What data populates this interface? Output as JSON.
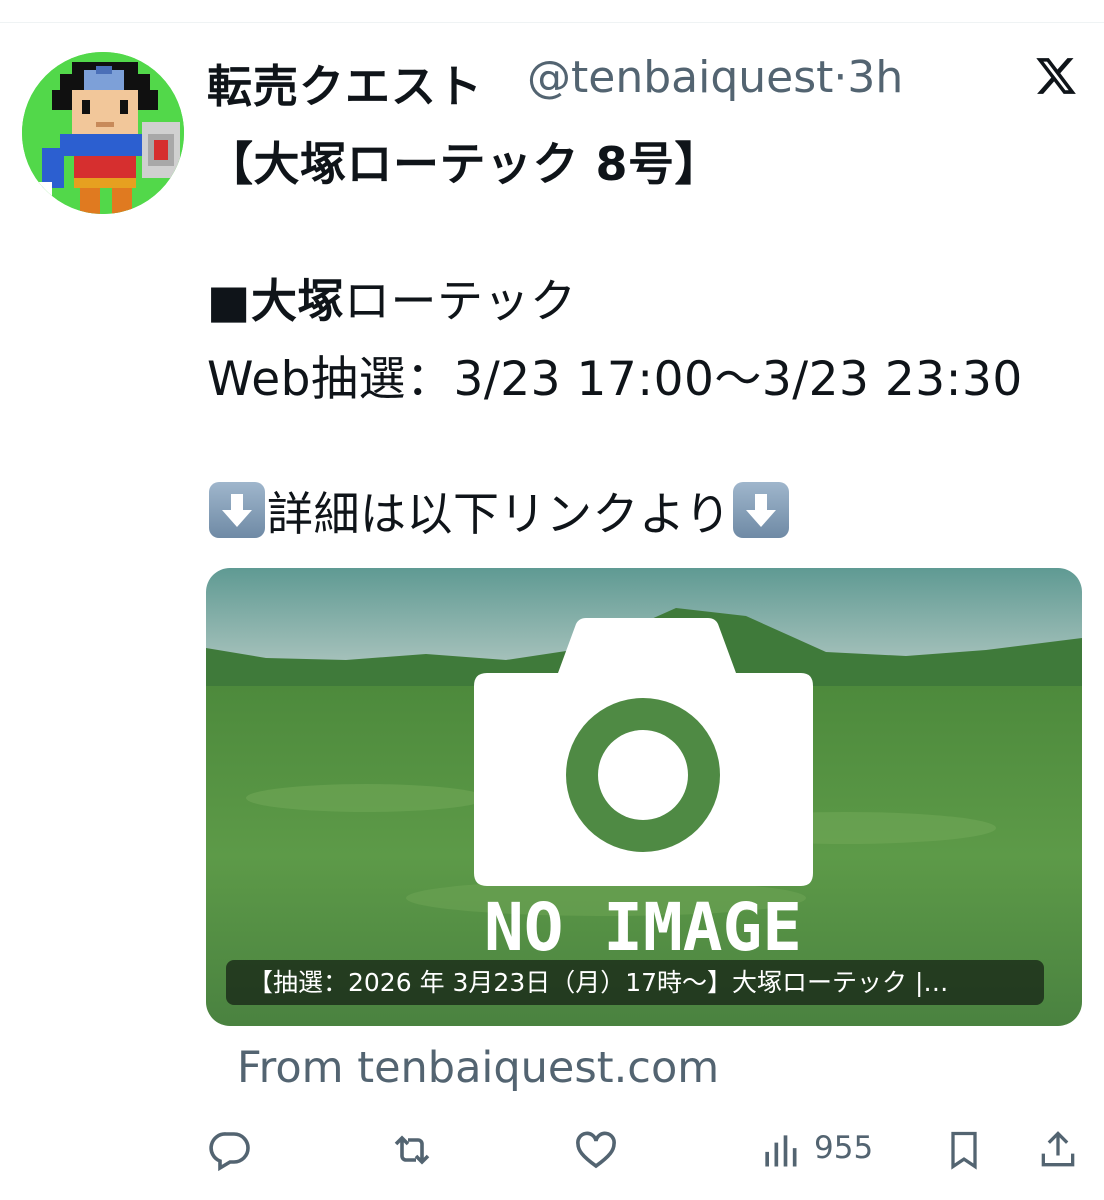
{
  "tweet": {
    "display_name": "転売クエスト",
    "handle_time": "@tenbaiquest·3h",
    "line1": "【大塚ローテック 8号】",
    "line2_prefix": "■",
    "line2_bold": "大塚",
    "line2_rest": "ローテック",
    "line3": "Web抽選：3/23 17:00〜3/23 23:30",
    "line4": "詳細は以下リンクより"
  },
  "card": {
    "image_text": "NO IMAGE",
    "label": "【抽選：2026 年 3月23日（月）17時〜】大塚ローテック |…",
    "from": "From tenbaiquest.com"
  },
  "actions": {
    "views": "955",
    "icons": [
      "reply-icon",
      "retweet-icon",
      "like-icon",
      "views-icon",
      "bookmark-icon",
      "share-icon"
    ]
  },
  "colors": {
    "text": "#0f1419",
    "secondary": "#536471",
    "card_green": "#4f8a44"
  }
}
